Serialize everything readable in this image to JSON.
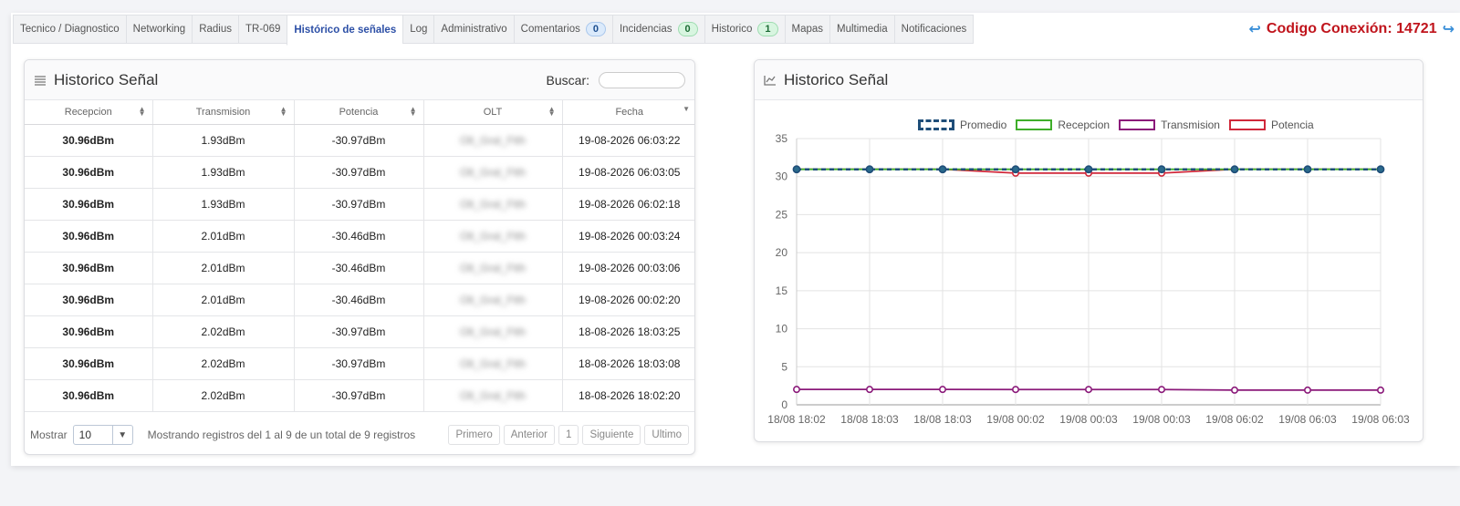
{
  "tabs": [
    {
      "label": "Tecnico / Diagnostico",
      "active": false
    },
    {
      "label": "Networking",
      "active": false
    },
    {
      "label": "Radius",
      "active": false
    },
    {
      "label": "TR-069",
      "active": false
    },
    {
      "label": "Histórico de señales",
      "active": true
    },
    {
      "label": "Log",
      "active": false
    },
    {
      "label": "Administrativo",
      "active": false
    },
    {
      "label": "Comentarios",
      "badge": "0",
      "badge_color": "blue",
      "active": false
    },
    {
      "label": "Incidencias",
      "badge": "0",
      "badge_color": "green",
      "active": false
    },
    {
      "label": "Historico",
      "badge": "1",
      "badge_color": "green",
      "active": false
    },
    {
      "label": "Mapas",
      "active": false
    },
    {
      "label": "Multimedia",
      "active": false
    },
    {
      "label": "Notificaciones",
      "active": false
    }
  ],
  "connection": {
    "label": "Codigo Conexión: 14721"
  },
  "table_card": {
    "title": "Historico Señal",
    "search_label": "Buscar:",
    "search_value": "",
    "columns": [
      "Recepcion",
      "Transmision",
      "Potencia",
      "OLT",
      "Fecha"
    ],
    "rows": [
      [
        "30.96dBm",
        "1.93dBm",
        "-30.97dBm",
        "Olt_Gral_Ftth",
        "19-08-2026 06:03:22"
      ],
      [
        "30.96dBm",
        "1.93dBm",
        "-30.97dBm",
        "Olt_Gral_Ftth",
        "19-08-2026 06:03:05"
      ],
      [
        "30.96dBm",
        "1.93dBm",
        "-30.97dBm",
        "Olt_Gral_Ftth",
        "19-08-2026 06:02:18"
      ],
      [
        "30.96dBm",
        "2.01dBm",
        "-30.46dBm",
        "Olt_Gral_Ftth",
        "19-08-2026 00:03:24"
      ],
      [
        "30.96dBm",
        "2.01dBm",
        "-30.46dBm",
        "Olt_Gral_Ftth",
        "19-08-2026 00:03:06"
      ],
      [
        "30.96dBm",
        "2.01dBm",
        "-30.46dBm",
        "Olt_Gral_Ftth",
        "19-08-2026 00:02:20"
      ],
      [
        "30.96dBm",
        "2.02dBm",
        "-30.97dBm",
        "Olt_Gral_Ftth",
        "18-08-2026 18:03:25"
      ],
      [
        "30.96dBm",
        "2.02dBm",
        "-30.97dBm",
        "Olt_Gral_Ftth",
        "18-08-2026 18:03:08"
      ],
      [
        "30.96dBm",
        "2.02dBm",
        "-30.97dBm",
        "Olt_Gral_Ftth",
        "18-08-2026 18:02:20"
      ]
    ],
    "show_label": "Mostrar",
    "page_size": "10",
    "info": "Mostrando registros del 1 al 9 de un total de 9 registros",
    "pager": [
      "Primero",
      "Anterior",
      "1",
      "Siguiente",
      "Ultimo"
    ]
  },
  "chart_card": {
    "title": "Historico Señal"
  },
  "chart_data": {
    "type": "line",
    "categories": [
      "18/08 18:02",
      "18/08 18:03",
      "18/08 18:03",
      "19/08 00:02",
      "19/08 00:03",
      "19/08 00:03",
      "19/08 06:02",
      "19/08 06:03",
      "19/08 06:03"
    ],
    "series": [
      {
        "name": "Promedio",
        "color": "#1f4e79",
        "values": [
          30.96,
          30.96,
          30.96,
          30.96,
          30.96,
          30.96,
          30.96,
          30.96,
          30.96
        ]
      },
      {
        "name": "Recepcion",
        "color": "#3fae2a",
        "values": [
          30.96,
          30.96,
          30.96,
          30.96,
          30.96,
          30.96,
          30.96,
          30.96,
          30.96
        ]
      },
      {
        "name": "Transmision",
        "color": "#8b1a7a",
        "values": [
          2.02,
          2.02,
          2.02,
          2.01,
          2.01,
          2.01,
          1.93,
          1.93,
          1.93
        ]
      },
      {
        "name": "Potencia",
        "color": "#d0283a",
        "values": [
          30.97,
          30.97,
          30.97,
          30.46,
          30.46,
          30.46,
          30.97,
          30.97,
          30.97
        ]
      }
    ],
    "y_ticks": [
      0,
      5,
      10,
      15,
      20,
      25,
      30,
      35
    ],
    "ylim": [
      0,
      35
    ],
    "grid": true,
    "legend": "top-center"
  }
}
